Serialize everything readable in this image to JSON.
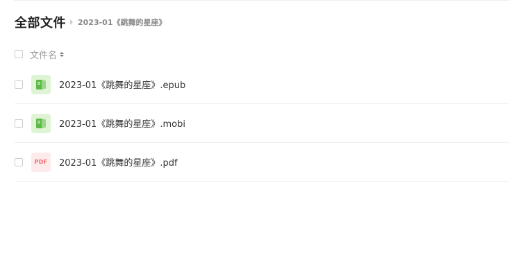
{
  "breadcrumb": {
    "root": "全部文件",
    "current": "2023-01《跳舞的星座》"
  },
  "list_header": {
    "name_column": "文件名"
  },
  "files": [
    {
      "name": "2023-01《跳舞的星座》.epub",
      "icon": "book-icon"
    },
    {
      "name": "2023-01《跳舞的星座》.mobi",
      "icon": "book-icon"
    },
    {
      "name": "2023-01《跳舞的星座》.pdf",
      "icon": "pdf-icon",
      "icon_label": "PDF"
    }
  ],
  "colors": {
    "book_icon_bg": "#dff3d5",
    "book_icon_fg": "#5db94a",
    "pdf_icon_bg": "#fdeaea",
    "pdf_icon_fg": "#f06b6b"
  }
}
